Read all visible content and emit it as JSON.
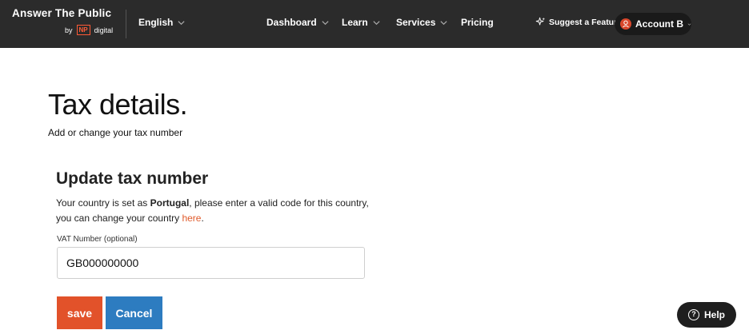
{
  "header": {
    "logo_title": "Answer The Public",
    "logo_by": "by",
    "logo_np": "NP",
    "logo_digital": "digital",
    "language": "English",
    "nav": [
      {
        "label": "Dashboard",
        "has_dropdown": true
      },
      {
        "label": "Learn",
        "has_dropdown": true
      },
      {
        "label": "Services",
        "has_dropdown": true
      },
      {
        "label": "Pricing",
        "has_dropdown": false
      }
    ],
    "suggest_label": "Suggest a Feature",
    "account_label": "Account B",
    "colors": {
      "bar": "#2b2b2b",
      "brand_accent": "#ff5a36"
    }
  },
  "main": {
    "title": "Tax details.",
    "subtitle": "Add or change your tax number",
    "section_title": "Update tax number",
    "notice_before": "Your country is set as ",
    "notice_country": "Portugal",
    "notice_middle": ", please enter a valid code for this country, you can change your country ",
    "notice_link": "here",
    "notice_after": ".",
    "vat_label": "VAT Number (optional)",
    "vat_value": "GB000000000",
    "save_label": "save",
    "cancel_label": "Cancel",
    "colors": {
      "save": "#e2522a",
      "cancel": "#2d7cc0",
      "link": "#e05a2b"
    }
  },
  "help": {
    "label": "Help",
    "icon": "question-circle-icon"
  }
}
